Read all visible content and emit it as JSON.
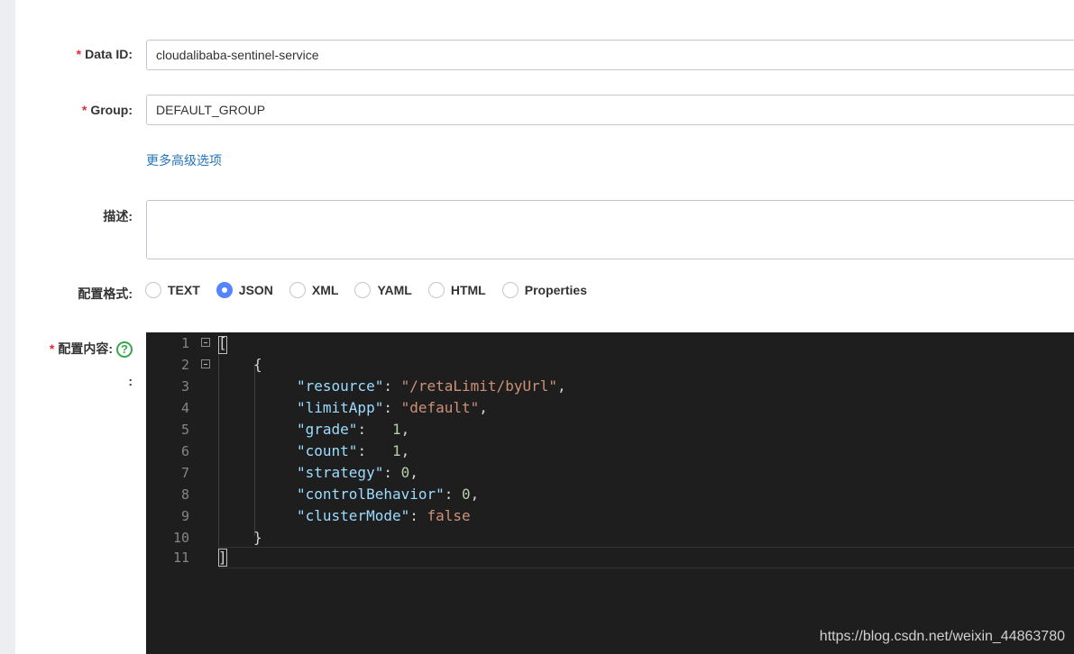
{
  "form": {
    "data_id": {
      "required_mark": "*",
      "label": "Data ID:",
      "value": "cloudalibaba-sentinel-service"
    },
    "group": {
      "required_mark": "*",
      "label": "Group:",
      "value": "DEFAULT_GROUP"
    },
    "advanced_link": "更多高级选项",
    "description": {
      "label": "描述:",
      "value": ""
    },
    "format": {
      "label": "配置格式:",
      "options": [
        "TEXT",
        "JSON",
        "XML",
        "YAML",
        "HTML",
        "Properties"
      ],
      "selected": "JSON"
    },
    "content": {
      "required_mark": "*",
      "label": "配置内容:",
      "colon": ":",
      "help_icon": "question-circle-icon",
      "help_glyph": "?"
    }
  },
  "editor": {
    "line_numbers": [
      "1",
      "2",
      "3",
      "4",
      "5",
      "6",
      "7",
      "8",
      "9",
      "10",
      "11"
    ],
    "lines": {
      "l1": "[",
      "l2": "{",
      "l3_key": "\"resource\"",
      "l3_sep": ": ",
      "l3_val": "\"/retaLimit/byUrl\"",
      "l3_end": ",",
      "l4_key": "\"limitApp\"",
      "l4_sep": ": ",
      "l4_val": "\"default\"",
      "l4_end": ",",
      "l5_key": "\"grade\"",
      "l5_sep": ":   ",
      "l5_val": "1",
      "l5_end": ",",
      "l6_key": "\"count\"",
      "l6_sep": ":   ",
      "l6_val": "1",
      "l6_end": ",",
      "l7_key": "\"strategy\"",
      "l7_sep": ": ",
      "l7_val": "0",
      "l7_end": ",",
      "l8_key": "\"controlBehavior\"",
      "l8_sep": ": ",
      "l8_val": "0",
      "l8_end": ",",
      "l9_key": "\"clusterMode\"",
      "l9_sep": ": ",
      "l9_val": "false",
      "l10": "}",
      "l11": "]"
    }
  },
  "watermark": "https://blog.csdn.net/weixin_44863780"
}
